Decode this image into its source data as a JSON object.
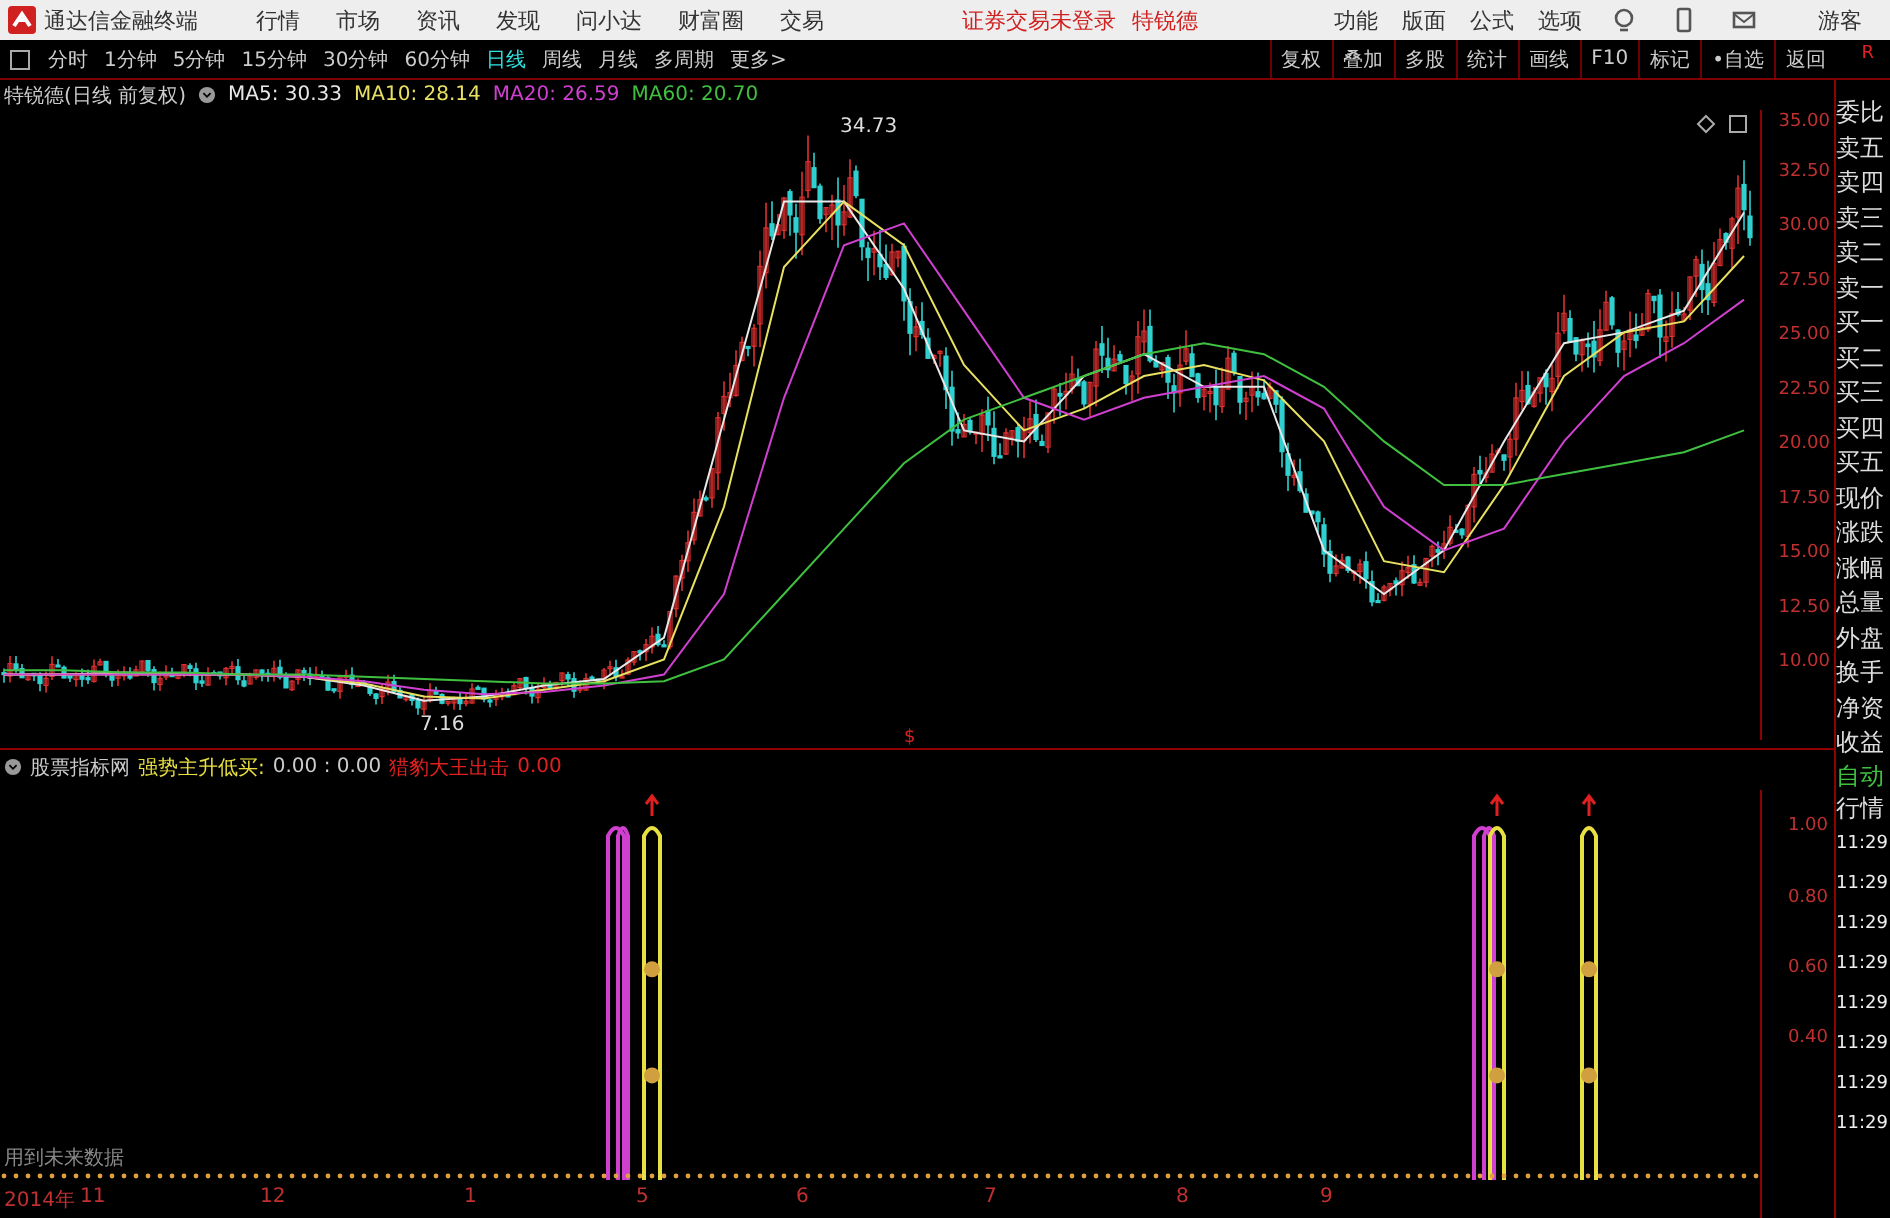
{
  "app": {
    "title": "通达信金融终端"
  },
  "menu": [
    "行情",
    "市场",
    "资讯",
    "发现",
    "问小达",
    "财富圈",
    "交易"
  ],
  "login_status": "证券交易未登录",
  "stock_link": "特锐德",
  "top_actions": [
    "功能",
    "版面",
    "公式",
    "选项"
  ],
  "user": "游客",
  "periods": [
    {
      "label": "分时",
      "selected": false
    },
    {
      "label": "1分钟",
      "selected": false
    },
    {
      "label": "5分钟",
      "selected": false
    },
    {
      "label": "15分钟",
      "selected": false
    },
    {
      "label": "30分钟",
      "selected": false
    },
    {
      "label": "60分钟",
      "selected": false
    },
    {
      "label": "日线",
      "selected": true
    },
    {
      "label": "周线",
      "selected": false
    },
    {
      "label": "月线",
      "selected": false
    },
    {
      "label": "多周期",
      "selected": false
    },
    {
      "label": "更多>",
      "selected": false
    }
  ],
  "tools": [
    "复权",
    "叠加",
    "多股",
    "统计",
    "画线",
    "F10",
    "标记",
    "•自选",
    "返回"
  ],
  "corner_label": "R",
  "price_panel": {
    "title": "特锐德(日线 前复权)",
    "high_label": "34.73",
    "low_label": "7.16",
    "marker": "$",
    "chart_data": {
      "type": "line",
      "ylim": [
        6.3,
        35.2
      ],
      "yticks": [
        {
          "value": 35,
          "label": "35.00"
        },
        {
          "value": 32.5,
          "label": "32.50"
        },
        {
          "value": 30,
          "label": "30.00"
        },
        {
          "value": 27.5,
          "label": "27.50"
        },
        {
          "value": 25,
          "label": "25.00"
        },
        {
          "value": 22.5,
          "label": "22.50"
        },
        {
          "value": 20,
          "label": "20.00"
        },
        {
          "value": 17.5,
          "label": "17.50"
        },
        {
          "value": 15,
          "label": "15.00"
        },
        {
          "value": 12.5,
          "label": "12.50"
        },
        {
          "value": 10,
          "label": "10.00"
        }
      ],
      "series": [
        {
          "name": "MA5: 30.33",
          "color": "#e8e8e8",
          "values": [
            9.3,
            9.3,
            9.4,
            9.3,
            9.3,
            9.2,
            8.8,
            8.1,
            8.3,
            8.8,
            9.1,
            11,
            21,
            31,
            31,
            27,
            20.5,
            20,
            23,
            24,
            22.5,
            22.5,
            15,
            13,
            15,
            20,
            24.5,
            25,
            26,
            30.5
          ]
        },
        {
          "name": "MA10: 28.14",
          "color": "#e8e060",
          "values": [
            9.3,
            9.3,
            9.3,
            9.3,
            9.3,
            9.2,
            8.9,
            8.3,
            8.2,
            8.6,
            9,
            10,
            17,
            28,
            31,
            29,
            23.5,
            20.5,
            21.5,
            23,
            23.5,
            22.8,
            20,
            14.5,
            14,
            18,
            23,
            25,
            25.5,
            28.5
          ]
        },
        {
          "name": "MA20: 26.59",
          "color": "#d040d0",
          "values": [
            9.3,
            9.3,
            9.3,
            9.3,
            9.3,
            9.2,
            9,
            8.6,
            8.4,
            8.5,
            8.8,
            9.3,
            13,
            22,
            29,
            30,
            26,
            22,
            21,
            22,
            22.5,
            23,
            21.5,
            17,
            15,
            16,
            20,
            23,
            24.5,
            26.5
          ]
        },
        {
          "name": "MA60: 20.70",
          "color": "#40c040",
          "values": [
            9.5,
            9.5,
            9.4,
            9.4,
            9.3,
            9.3,
            9.2,
            9.1,
            9,
            8.9,
            8.9,
            9,
            10,
            13,
            16,
            19,
            21,
            22,
            23,
            24,
            24.5,
            24,
            22.5,
            20,
            18,
            18,
            18.5,
            19,
            19.5,
            20.5
          ]
        }
      ]
    }
  },
  "indicator_panel": {
    "source": "股票指标网",
    "entries": [
      {
        "label": "强势主升低买:",
        "value": "0.00 : 0.00",
        "color": "#e8e040"
      },
      {
        "label": "猎豹大王出击",
        "value": "0.00",
        "color": "#e02020"
      }
    ],
    "note": "用到未来数据",
    "axis_labels": [
      "1.00",
      "0.80",
      "0.60",
      "0.40"
    ]
  },
  "side_panel": {
    "quote_labels": [
      "委比",
      "卖五",
      "卖四",
      "卖三",
      "卖二",
      "卖一",
      "买一",
      "买二",
      "买三",
      "买四",
      "买五",
      "现价",
      "涨跌",
      "涨幅",
      "总量",
      "外盘",
      "换手",
      "净资",
      "收益"
    ],
    "mode_labels": [
      "自动",
      "行情"
    ],
    "times": [
      "11:29",
      "11:29",
      "11:29",
      "11:29",
      "11:29",
      "11:29",
      "11:29",
      "11:29"
    ]
  },
  "time_axis": [
    "2014年",
    "11",
    "12",
    "1",
    "5",
    "6",
    "7",
    "8",
    "9"
  ]
}
